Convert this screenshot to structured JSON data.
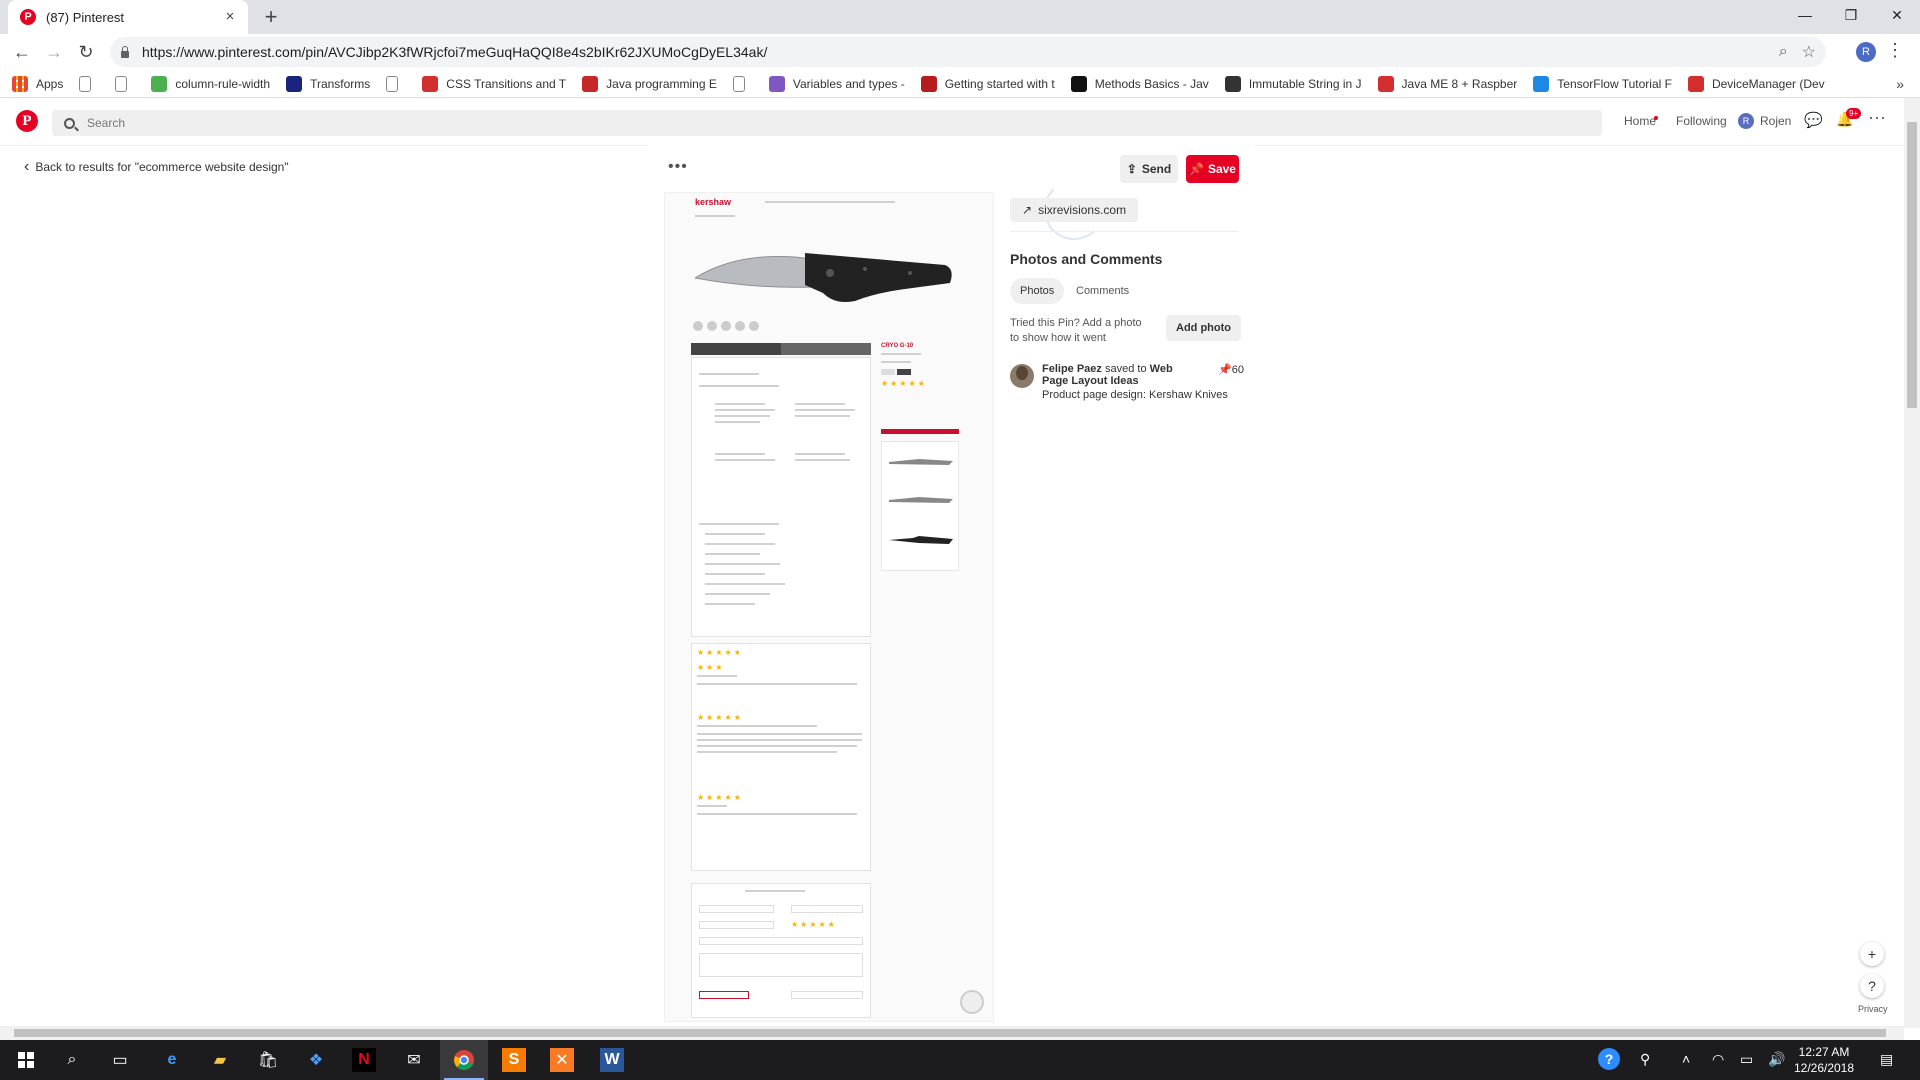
{
  "browser": {
    "tab_title": "(87) Pinterest",
    "url": "https://www.pinterest.com/pin/AVCJibp2K3fWRjcfoi7meGuqHaQQI8e4s2bIKr62JXUMoCgDyEL34ak/",
    "bookmarks": [
      {
        "label": "Apps",
        "icon": "apps-grid-icon",
        "color": "#e8453c"
      },
      {
        "label": "",
        "icon": "page-icon",
        "color": "#888888"
      },
      {
        "label": "",
        "icon": "page-icon",
        "color": "#888888"
      },
      {
        "label": "column-rule-width",
        "icon": "w3-icon",
        "color": "#4caf50"
      },
      {
        "label": "Transforms",
        "icon": "codrops-icon",
        "color": "#1a237e"
      },
      {
        "label": "",
        "icon": "page-icon",
        "color": "#888888"
      },
      {
        "label": "CSS Transitions and T",
        "icon": "css-icon",
        "color": "#d32f2f"
      },
      {
        "label": "Java programming E",
        "icon": "java-icon",
        "color": "#c62828"
      },
      {
        "label": "",
        "icon": "page-icon",
        "color": "#888888"
      },
      {
        "label": "Variables and types -",
        "icon": "learn-icon",
        "color": "#7e57c2"
      },
      {
        "label": "Getting started with t",
        "icon": "getting-started-icon",
        "color": "#b71c1c"
      },
      {
        "label": "Methods Basics - Jav",
        "icon": "sf-icon",
        "color": "#111111"
      },
      {
        "label": "Immutable String in J",
        "icon": "t-icon",
        "color": "#333333"
      },
      {
        "label": "Java ME 8 + Raspber",
        "icon": "oracle-icon",
        "color": "#d32f2f"
      },
      {
        "label": "TensorFlow Tutorial F",
        "icon": "shield-icon",
        "color": "#1e88e5"
      },
      {
        "label": "DeviceManager (Dev",
        "icon": "oracle-icon",
        "color": "#d32f2f"
      }
    ]
  },
  "pinterest": {
    "search_placeholder": "Search",
    "nav_home": "Home",
    "nav_following": "Following",
    "user_initial": "R",
    "user_name": "Rojen",
    "notif_count": "9+",
    "back_text": "Back to results for \"ecommerce website design\"",
    "send_label": "Send",
    "save_label": "Save",
    "source": "sixrevisions.com",
    "photos_comments_title": "Photos and Comments",
    "tab_photos": "Photos",
    "tab_comments": "Comments",
    "tried_text": "Tried this Pin? Add a photo to show how it went",
    "add_photo_label": "Add photo",
    "saver_name": "Felipe Paez",
    "saved_to": "saved to",
    "board_name": "Web Page Layout Ideas",
    "saves_count": "60",
    "pin_description": "Product page design: Kershaw Knives",
    "privacy": "Privacy"
  },
  "pin_mockup": {
    "brand": "kershaw",
    "product_name": "CRYO G-10"
  },
  "taskbar": {
    "time": "12:27 AM",
    "date": "12/26/2018"
  },
  "colors": {
    "pinterest_red": "#e60023",
    "taskbar_bg": "#1c1c1e"
  }
}
